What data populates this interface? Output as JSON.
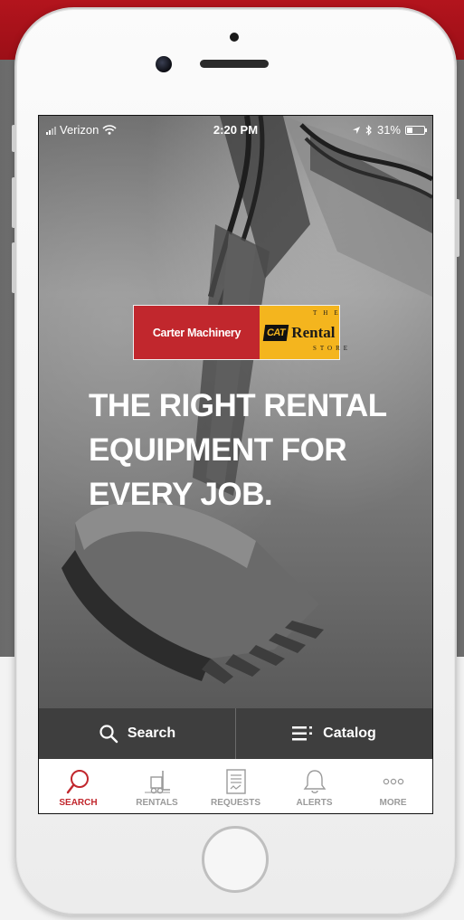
{
  "status_bar": {
    "carrier": "Verizon",
    "time": "2:20 PM",
    "battery": "31%",
    "battery_level": 0.31
  },
  "brand": {
    "dealer": "Carter Machinery",
    "cat": "CAT",
    "rental": "Rental",
    "the": "THE",
    "store": "STORE",
    "colors": {
      "red": "#c1272d",
      "yellow": "#f4b51e"
    }
  },
  "hero": {
    "headline_lines": [
      "THE RIGHT RENTAL",
      "EQUIPMENT FOR",
      "EVERY JOB."
    ]
  },
  "actions": [
    {
      "label": "Search",
      "icon": "search-icon"
    },
    {
      "label": "Catalog",
      "icon": "list-icon"
    }
  ],
  "tabs": [
    {
      "label": "SEARCH",
      "icon": "search-icon",
      "active": true
    },
    {
      "label": "RENTALS",
      "icon": "forklift-icon",
      "active": false
    },
    {
      "label": "REQUESTS",
      "icon": "document-icon",
      "active": false
    },
    {
      "label": "ALERTS",
      "icon": "bell-icon",
      "active": false
    },
    {
      "label": "MORE",
      "icon": "more-icon",
      "active": false
    }
  ]
}
